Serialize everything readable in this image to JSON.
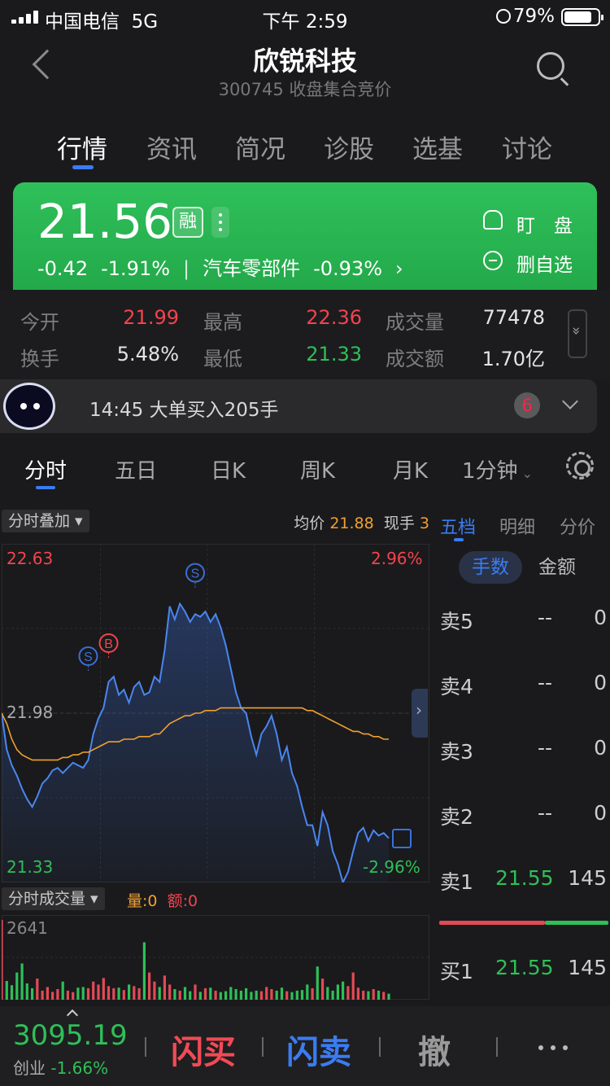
{
  "status_bar": {
    "carrier": "中国电信",
    "network": "5G",
    "time": "下午 2:59",
    "battery": "79%"
  },
  "header": {
    "title": "欣锐科技",
    "subtitle": "300745 收盘集合竞价"
  },
  "tabs": [
    "行情",
    "资讯",
    "简况",
    "诊股",
    "选基",
    "讨论"
  ],
  "quote": {
    "price": "21.56",
    "rong_badge": "融",
    "change": "-0.42",
    "change_pct": "-1.91%",
    "separator": "|",
    "sector": "汽车零部件",
    "sector_change": "-0.93%",
    "sector_arrow": "›",
    "watch_label": "盯　盘",
    "remove_label": "删自选"
  },
  "stats": {
    "open_label": "今开",
    "open": "21.99",
    "high_label": "最高",
    "high": "22.36",
    "volume_label": "成交量",
    "volume": "77478",
    "turnover_label": "换手",
    "turnover": "5.48%",
    "low_label": "最低",
    "low": "21.33",
    "amount_label": "成交额",
    "amount": "1.70亿"
  },
  "news": {
    "text": "14:45 大单买入205手",
    "badge": "6"
  },
  "chart_tabs": [
    "分时",
    "五日",
    "日K",
    "周K",
    "月K",
    "1分钟"
  ],
  "chart_header": {
    "overlay": "分时叠加",
    "avg_label": "均价",
    "avg_value": "21.88",
    "last_label": "现手",
    "last_value": "3"
  },
  "chart_labels": {
    "top_price": "22.63",
    "top_pct": "2.96%",
    "mid_price": "21.98",
    "bottom_price": "21.33",
    "bottom_pct": "-2.96%"
  },
  "markers": {
    "sell": "S",
    "buy": "B"
  },
  "volume_header": {
    "title": "分时成交量",
    "vol_label": "量:",
    "vol_value": "0",
    "amt_label": "额:",
    "amt_value": "0",
    "max": "2641"
  },
  "orderbook": {
    "tabs": [
      "五档",
      "明细",
      "分价"
    ],
    "units": [
      "手数",
      "金额"
    ],
    "asks": [
      {
        "label": "卖5",
        "price": "--",
        "vol": "0"
      },
      {
        "label": "卖4",
        "price": "--",
        "vol": "0"
      },
      {
        "label": "卖3",
        "price": "--",
        "vol": "0"
      },
      {
        "label": "卖2",
        "price": "--",
        "vol": "0"
      },
      {
        "label": "卖1",
        "price": "21.55",
        "vol": "145"
      }
    ],
    "bids": [
      {
        "label": "买1",
        "price": "21.55",
        "vol": "145"
      }
    ]
  },
  "bottom": {
    "index_value": "3095.19",
    "index_name": "创业",
    "index_change": "-1.66%",
    "flash_buy": "闪买",
    "flash_sell": "闪卖",
    "cancel": "撤"
  },
  "chart_data": {
    "type": "line",
    "ylim": [
      21.33,
      22.63
    ],
    "y_ref": 21.98,
    "series": [
      {
        "values": [
          21.98,
          21.84,
          21.78,
          21.74,
          21.69,
          21.65,
          21.62,
          21.66,
          21.71,
          21.73,
          21.76,
          21.77,
          21.75,
          21.77,
          21.79,
          21.78,
          21.77,
          21.8,
          21.9,
          21.96,
          22.0,
          22.1,
          22.12,
          22.05,
          22.07,
          22.02,
          22.08,
          22.1,
          22.05,
          22.06,
          22.12,
          22.1,
          22.22,
          22.39,
          22.34,
          22.4,
          22.37,
          22.33,
          22.36,
          22.35,
          22.37,
          22.33,
          22.36,
          22.31,
          22.24,
          22.15,
          22.06,
          22.0,
          21.98,
          21.89,
          21.82,
          21.9,
          21.93,
          21.97,
          21.9,
          21.8,
          21.85,
          21.75,
          21.7,
          21.62,
          21.55,
          21.55,
          21.47,
          21.6,
          21.55,
          21.45,
          21.4,
          21.33,
          21.37,
          21.45,
          21.52,
          21.54,
          21.49,
          21.53,
          21.51,
          21.52,
          21.5
        ]
      },
      {
        "values": [
          21.98,
          21.94,
          21.88,
          21.84,
          21.82,
          21.81,
          21.8,
          21.8,
          21.8,
          21.8,
          21.8,
          21.8,
          21.81,
          21.81,
          21.82,
          21.82,
          21.83,
          21.83,
          21.84,
          21.85,
          21.86,
          21.87,
          21.87,
          21.87,
          21.88,
          21.88,
          21.88,
          21.89,
          21.89,
          21.89,
          21.9,
          21.9,
          21.92,
          21.94,
          21.95,
          21.96,
          21.97,
          21.97,
          21.98,
          21.98,
          21.99,
          21.99,
          21.99,
          22.0,
          22.0,
          22.0,
          22.0,
          22.0,
          22.0,
          22.0,
          22.0,
          22.0,
          22.0,
          22.0,
          22.0,
          22.0,
          22.0,
          22.0,
          22.0,
          22.0,
          21.99,
          21.99,
          21.98,
          21.97,
          21.96,
          21.95,
          21.94,
          21.93,
          21.92,
          21.91,
          21.91,
          21.9,
          21.9,
          21.89,
          21.89,
          21.88,
          21.88
        ]
      }
    ],
    "volume": [
      2641,
      620,
      480,
      900,
      1200,
      540,
      380,
      700,
      300,
      420,
      260,
      350,
      600,
      300,
      250,
      400,
      420,
      380,
      600,
      500,
      720,
      450,
      380,
      400,
      320,
      500,
      450,
      380,
      1900,
      900,
      600,
      420,
      800,
      500,
      350,
      300,
      420,
      280,
      500,
      260,
      380,
      400,
      300,
      250,
      280,
      420,
      350,
      300,
      380,
      260,
      300,
      280,
      420,
      350,
      300,
      400,
      280,
      250,
      300,
      320,
      500,
      380,
      1100,
      700,
      420,
      300,
      500,
      600,
      450,
      900,
      400,
      300,
      280,
      350,
      300,
      260,
      200
    ]
  }
}
